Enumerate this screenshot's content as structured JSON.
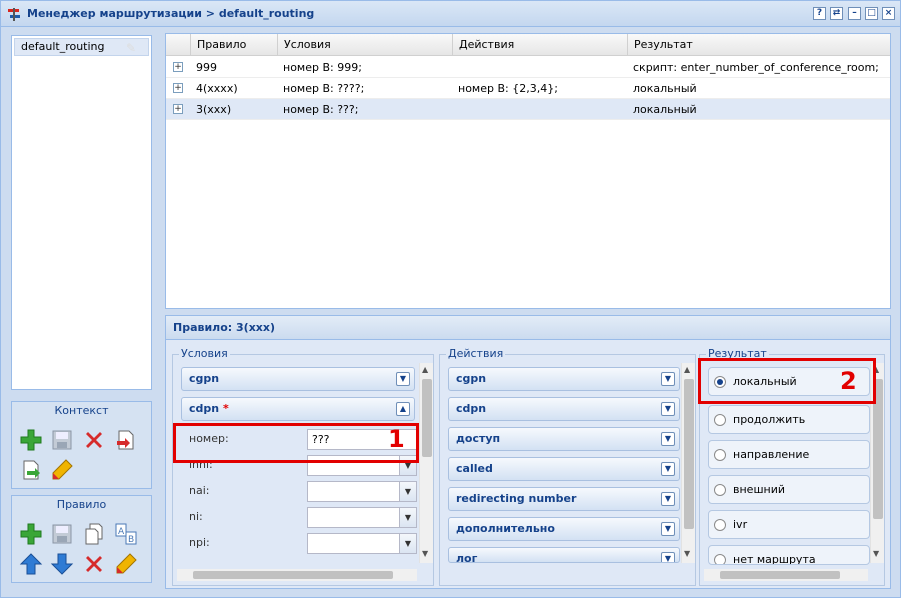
{
  "window": {
    "title": "Менеджер маршрутизации > default_routing",
    "buttons": [
      "?",
      "⇄",
      "–",
      "□",
      "×"
    ]
  },
  "contexts": {
    "items": [
      {
        "label": "default_routing"
      }
    ]
  },
  "toolbox_context": {
    "label": "Контекст"
  },
  "toolbox_rule": {
    "label": "Правило"
  },
  "grid": {
    "columns": [
      "Правило",
      "Условия",
      "Действия",
      "Результат"
    ],
    "rows": [
      {
        "rule": "999",
        "conditions": "номер B: 999;",
        "actions": "",
        "result": "скрипт: enter_number_of_conference_room;"
      },
      {
        "rule": "4(xxxx)",
        "conditions": "номер B: ????;",
        "actions": "номер B: {2,3,4};",
        "result": "локальный"
      },
      {
        "rule": "3(xxx)",
        "conditions": "номер B: ???;",
        "actions": "",
        "result": "локальный"
      }
    ],
    "expander_glyph": "+"
  },
  "editor": {
    "title": "Правило: 3(xxx)",
    "conditions": {
      "legend": "Условия",
      "sections": [
        {
          "label": "cgpn",
          "expanded": false
        },
        {
          "label": "cdpn",
          "required_mark": "*",
          "expanded": true
        }
      ],
      "fields": [
        {
          "label": "номер:",
          "value": "???"
        },
        {
          "label": "inni:",
          "value": ""
        },
        {
          "label": "nai:",
          "value": ""
        },
        {
          "label": "ni:",
          "value": ""
        },
        {
          "label": "npi:",
          "value": ""
        }
      ]
    },
    "actions": {
      "legend": "Действия",
      "sections": [
        {
          "label": "cgpn"
        },
        {
          "label": "cdpn"
        },
        {
          "label": "доступ"
        },
        {
          "label": "called"
        },
        {
          "label": "redirecting number"
        },
        {
          "label": "дополнительно"
        },
        {
          "label": "лог"
        }
      ]
    },
    "result": {
      "legend": "Результат",
      "options": [
        {
          "label": "локальный",
          "selected": true
        },
        {
          "label": "продолжить",
          "selected": false
        },
        {
          "label": "направление",
          "selected": false
        },
        {
          "label": "внешний",
          "selected": false
        },
        {
          "label": "ivr",
          "selected": false
        },
        {
          "label": "нет маршрута",
          "selected": false
        }
      ]
    }
  },
  "callouts": [
    {
      "number": "1",
      "target": "номер-field"
    },
    {
      "number": "2",
      "target": "result-локальный"
    }
  ],
  "colors": {
    "accent": "#15428b",
    "callout": "#e20000",
    "selection": "#dfe8f6"
  }
}
